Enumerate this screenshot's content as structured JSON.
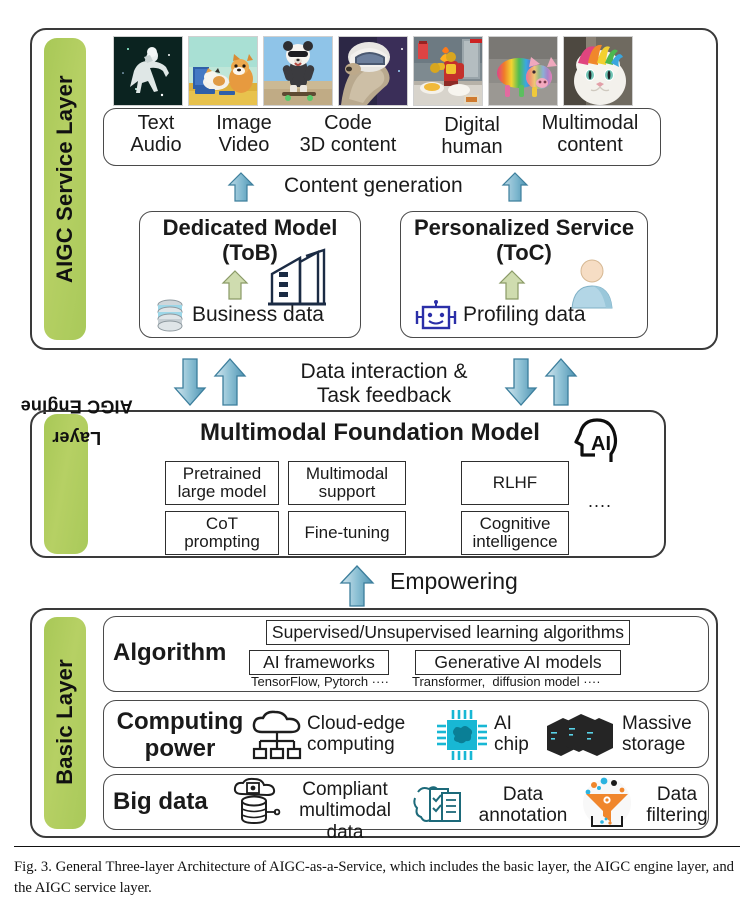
{
  "figure": {
    "caption": "Fig. 3.  General Three-layer Architecture of AIGC-as-a-Service, which includes the basic layer, the AIGC engine layer, and the AIGC service layer.",
    "accent_green": "#b0cc5e",
    "accent_blue": "#4d9ec0",
    "accent_olive": "#c8d6a0"
  },
  "service_layer": {
    "tab_label": "AIGC Service Layer",
    "thumbnails": [
      {
        "name": "astronaut-riding-horse-thumbnail",
        "alt": "astronaut riding a white horse in space"
      },
      {
        "name": "cat-and-corgi-painting-thumbnail",
        "alt": "painted cat and corgi at a desk"
      },
      {
        "name": "panda-skateboard-thumbnail",
        "alt": "panda in leather jacket on a skateboard"
      },
      {
        "name": "dog-helmet-thumbnail",
        "alt": "dog wearing a futuristic helmet"
      },
      {
        "name": "iron-man-cooking-thumbnail",
        "alt": "armored figure cooking in a kitchen"
      },
      {
        "name": "rainbow-pig-thumbnail",
        "alt": "rainbow striped pig"
      },
      {
        "name": "rainbow-hair-cat-thumbnail",
        "alt": "white cat with rainbow hair"
      }
    ],
    "outputs": {
      "row1": [
        "Text",
        "Image",
        "Code",
        "Digital",
        "Multimodal"
      ],
      "row2": [
        "Audio",
        "Video",
        "3D content",
        "human",
        "content"
      ]
    },
    "content_generation_label": "Content generation",
    "dedicated_model": {
      "title_line1": "Dedicated Model",
      "title_line2": "(ToB)",
      "data_label": "Business data",
      "data_icon": "database-icon",
      "entity_icon": "office-building-icon"
    },
    "personalized_service": {
      "title_line1": "Personalized Service",
      "title_line2": "(ToC)",
      "data_label": "Profiling data",
      "data_icon": "robot-icon",
      "entity_icon": "user-person-icon"
    }
  },
  "interconnect": {
    "label_line1": "Data interaction &",
    "label_line2": "Task feedback"
  },
  "engine_layer": {
    "tab_label_line1": "AIGC Engine",
    "tab_label_line2": "Layer",
    "title": "Multimodal Foundation Model",
    "badge_icon": "ai-head-icon",
    "badge_text": "AI",
    "capabilities_row1": [
      "Pretrained\nlarge model",
      "Multimodal\nsupport",
      "RLHF"
    ],
    "capabilities_row2": [
      "CoT\nprompting",
      "Fine-tuning",
      "Cognitive\nintelligence"
    ],
    "ellipsis": "...."
  },
  "empowering": {
    "label": "Empowering"
  },
  "basic_layer": {
    "tab_label": "Basic Layer",
    "algorithm": {
      "title": "Algorithm",
      "top_box": "Supervised/Unsupervised learning algorithms",
      "left_box": "AI frameworks",
      "left_caption": "TensorFlow, Pytorch ····",
      "right_box": "Generative AI models",
      "right_caption": "Transformer,  diffusion model ····"
    },
    "computing": {
      "title_line1": "Computing",
      "title_line2": "power",
      "items": [
        {
          "icon": "cloud-network-icon",
          "line1": "Cloud-edge",
          "line2": "computing"
        },
        {
          "icon": "ai-chip-icon",
          "line1": "AI",
          "line2": "chip"
        },
        {
          "icon": "server-rack-icon",
          "line1": "Massive",
          "line2": "storage"
        }
      ]
    },
    "big_data": {
      "title": "Big data",
      "items": [
        {
          "icon": "cloud-database-icon",
          "line1": "Compliant",
          "line2": "multimodal",
          "line3": "data"
        },
        {
          "icon": "annotation-document-icon",
          "line1": "Data",
          "line2": "annotation"
        },
        {
          "icon": "funnel-filter-icon",
          "line1": "Data",
          "line2": "filtering"
        }
      ]
    }
  }
}
